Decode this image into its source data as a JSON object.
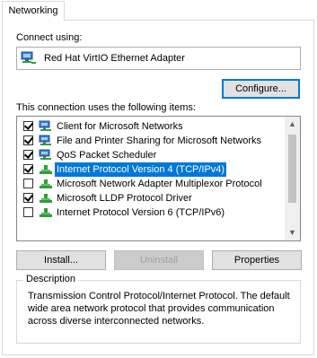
{
  "tab": {
    "label": "Networking"
  },
  "connect_using": {
    "label": "Connect using:",
    "adapter_name": "Red Hat VirtIO Ethernet Adapter",
    "adapter_icon": "network-adapter-icon"
  },
  "buttons": {
    "configure": "Configure...",
    "install": "Install...",
    "uninstall": "Uninstall",
    "properties": "Properties"
  },
  "items_label": "This connection uses the following items:",
  "items": [
    {
      "label": "Client for Microsoft Networks",
      "checked": true,
      "icon": "network-client-icon",
      "selected": false
    },
    {
      "label": "File and Printer Sharing for Microsoft Networks",
      "checked": true,
      "icon": "network-service-icon",
      "selected": false
    },
    {
      "label": "QoS Packet Scheduler",
      "checked": true,
      "icon": "network-service-icon",
      "selected": false
    },
    {
      "label": "Internet Protocol Version 4 (TCP/IPv4)",
      "checked": true,
      "icon": "network-protocol-icon",
      "selected": true
    },
    {
      "label": "Microsoft Network Adapter Multiplexor Protocol",
      "checked": false,
      "icon": "network-protocol-icon",
      "selected": false
    },
    {
      "label": "Microsoft LLDP Protocol Driver",
      "checked": true,
      "icon": "network-protocol-icon",
      "selected": false
    },
    {
      "label": "Internet Protocol Version 6 (TCP/IPv6)",
      "checked": false,
      "icon": "network-protocol-icon",
      "selected": false
    }
  ],
  "description": {
    "title": "Description",
    "text": "Transmission Control Protocol/Internet Protocol. The default wide area network protocol that provides communication across diverse interconnected networks."
  },
  "colors": {
    "accent": "#0078d7",
    "border": "#d9d9d9",
    "button_bg": "#e1e1e1"
  }
}
